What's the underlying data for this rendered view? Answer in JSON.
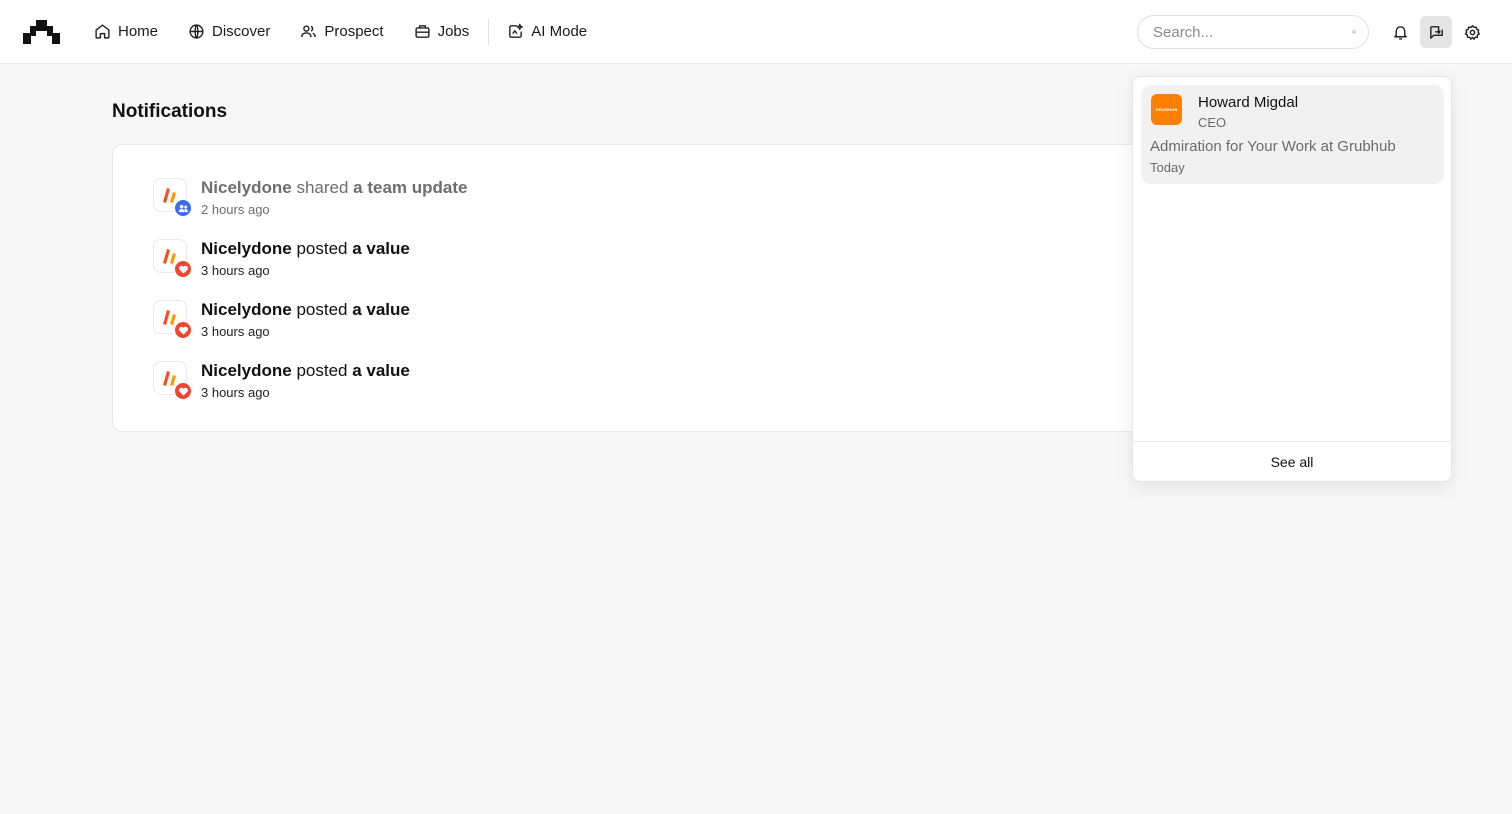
{
  "nav": {
    "items": [
      {
        "label": "Home",
        "icon": "home-icon"
      },
      {
        "label": "Discover",
        "icon": "globe-icon"
      },
      {
        "label": "Prospect",
        "icon": "users-icon"
      },
      {
        "label": "Jobs",
        "icon": "briefcase-icon"
      },
      {
        "label": "AI Mode",
        "icon": "sparkle-icon"
      }
    ]
  },
  "search": {
    "placeholder": "Search...",
    "value": ""
  },
  "header_icons": [
    "bell-icon",
    "message-icon",
    "gear-icon"
  ],
  "page": {
    "title": "Notifications"
  },
  "notifications": [
    {
      "actor": "Nicelydone",
      "verb": "shared",
      "object": "a team update",
      "time": "2 hours ago",
      "badge": "team-icon",
      "read": true
    },
    {
      "actor": "Nicelydone",
      "verb": "posted",
      "object": "a value",
      "time": "3 hours ago",
      "badge": "heart-icon",
      "read": false
    },
    {
      "actor": "Nicelydone",
      "verb": "posted",
      "object": "a value",
      "time": "3 hours ago",
      "badge": "heart-icon",
      "read": false
    },
    {
      "actor": "Nicelydone",
      "verb": "posted",
      "object": "a value",
      "time": "3 hours ago",
      "badge": "heart-icon",
      "read": false
    }
  ],
  "messages_dropdown": {
    "items": [
      {
        "sender": "Howard Migdal",
        "role": "CEO",
        "subject": "Admiration for Your Work at Grubhub",
        "date": "Today",
        "logo_text": "GRUBHUB"
      }
    ],
    "see_all": "See all"
  },
  "colors": {
    "brand_orange": "#ff8000",
    "team_badge": "#3b6cf0",
    "heart_badge": "#f0452e",
    "page_bg": "#f7f7f7"
  }
}
